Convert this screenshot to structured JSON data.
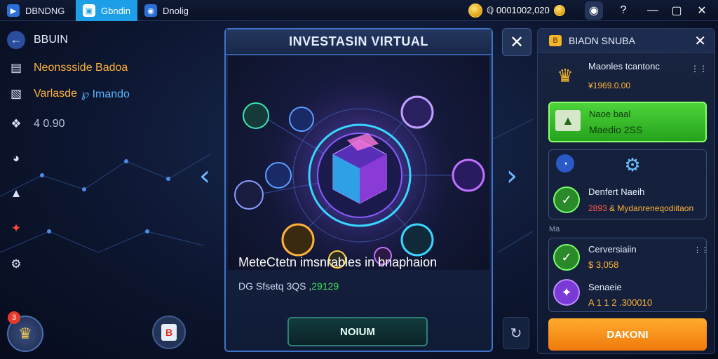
{
  "topbar": {
    "tabs": [
      {
        "label": "DBNDNG",
        "icon": "play-store-icon"
      },
      {
        "label": "Gbndin",
        "icon": "app-icon"
      },
      {
        "label": "Dnolig",
        "icon": "globe-icon"
      }
    ],
    "balance": "0001002,020",
    "window_buttons": [
      "shield-icon",
      "help-icon",
      "minimize-icon",
      "maximize-icon",
      "close-icon"
    ]
  },
  "sidebar": {
    "back_label": "BBUIN",
    "items": [
      {
        "label": "Neonssside Badoa",
        "icon": "film-icon"
      },
      {
        "label": "Varlasde",
        "label_accent": "℘ Imando",
        "icon": "wallet-icon"
      },
      {
        "label": "4 0.90",
        "icon": "award-icon"
      }
    ],
    "icons": [
      "chart-icon",
      "shirt-icon",
      "rocket-icon",
      "settings-icon"
    ],
    "notification_count": "3"
  },
  "modal": {
    "title": "INVESTASIN VIRTUAL",
    "description": "MeteCtetn imsnrables in bnaphaion",
    "sub_prefix": "DG Sfsetq 3QS ,",
    "sub_green": "29129",
    "button_label": "NOIUM"
  },
  "right_panel": {
    "title": "BIADN SNUBA",
    "header_badge": "B",
    "item1": {
      "title": "Maonles tcantonc",
      "value": "¥1969.0.00"
    },
    "green_card": {
      "title": "Naoe baal",
      "subtitle": "Maedio 2SS"
    },
    "item2": {
      "title": "Denfert Naeih",
      "value": "2893",
      "value_tail": "& Mydanreneqodiitaon"
    },
    "section_label": "Ma",
    "item3": {
      "title": "Cerversiaiin",
      "value": "$ 3,058"
    },
    "item4": {
      "title": "Senaeie",
      "value": "A 1 1 2 .300010"
    },
    "action_label": "DAKONI"
  }
}
